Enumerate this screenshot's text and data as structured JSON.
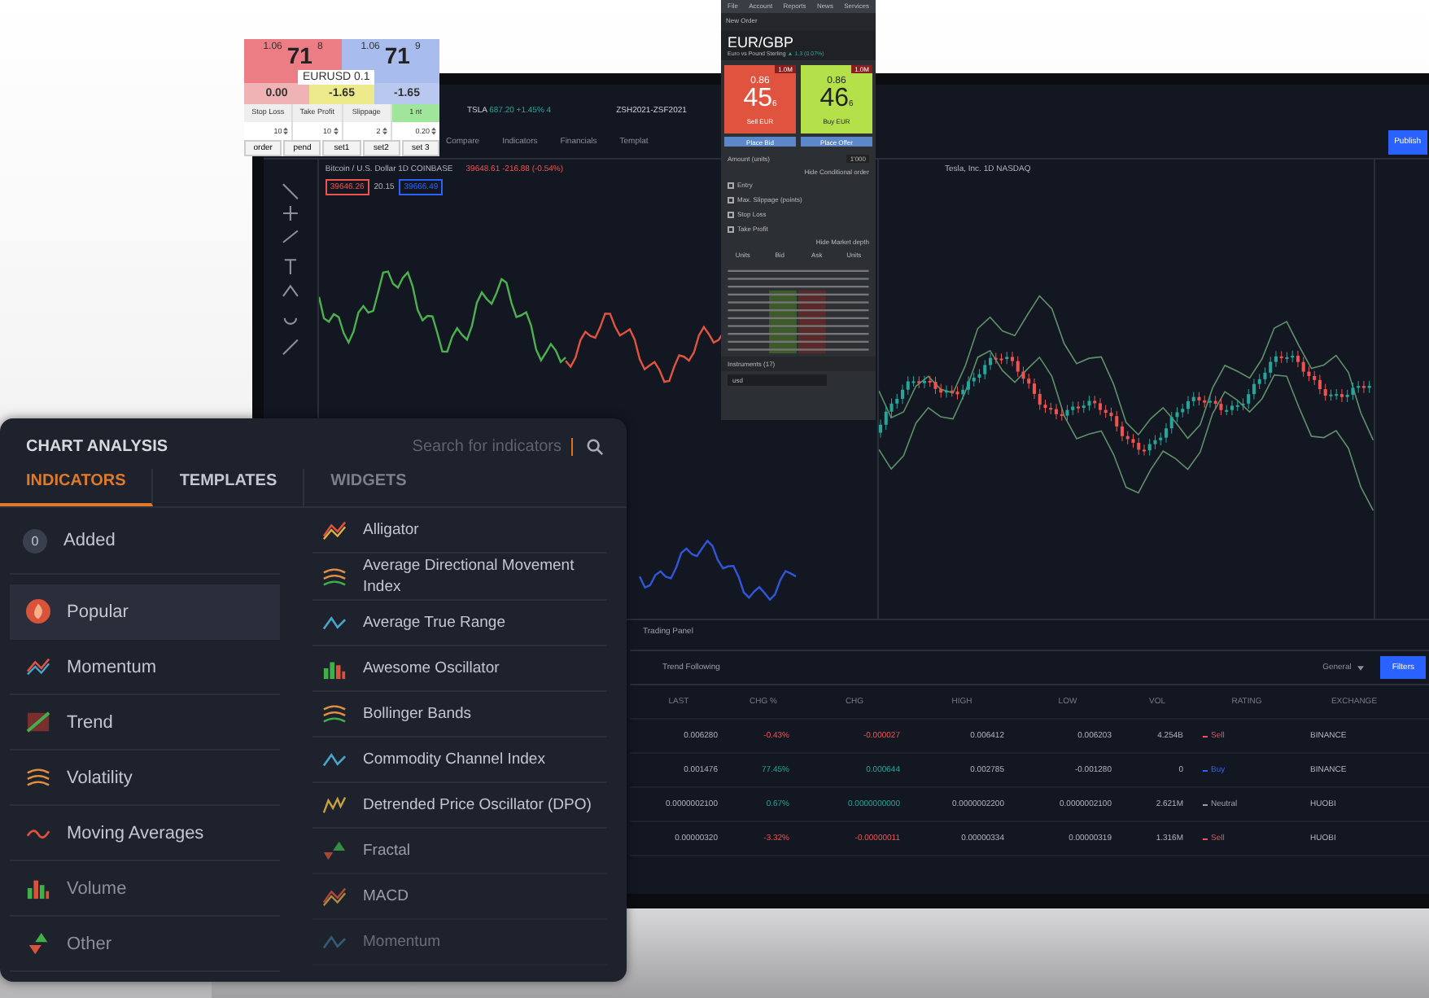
{
  "price_widget": {
    "bid": {
      "small": "1.06",
      "big": "71",
      "pip": "8"
    },
    "ask": {
      "small": "1.06",
      "big": "71",
      "pip": "9"
    },
    "symbol": "EURUSD 0.1",
    "values": [
      "0.00",
      "-1.65",
      "-1.65"
    ],
    "fields": [
      {
        "label": "Stop Loss",
        "value": "10",
        "selected": false
      },
      {
        "label": "Take Profit",
        "value": "10",
        "selected": false
      },
      {
        "label": "Slippage",
        "value": "2",
        "selected": false
      },
      {
        "label": "1 nt",
        "value": "0.20",
        "selected": true
      }
    ],
    "buttons": [
      "order",
      "pend",
      "set1",
      "set2",
      "set 3"
    ]
  },
  "order_panel": {
    "menu": [
      "File",
      "Account",
      "Reports",
      "News",
      "Services"
    ],
    "title": "New Order",
    "pair": "EUR/GBP",
    "pair_name": "Euro vs Pound Sterling",
    "change": "▲ 1.3 (0.07%)",
    "quotes": [
      {
        "kind": "sell",
        "small": "0.86",
        "big": "45",
        "pip": "6",
        "label": "Sell EUR",
        "tag": "1.0M",
        "button": "Place Bid"
      },
      {
        "kind": "buy",
        "small": "0.86",
        "big": "46",
        "pip": "6",
        "label": "Buy EUR",
        "tag": "1.0M",
        "button": "Place Offer"
      }
    ],
    "amount_label": "Amount (units)",
    "amount": "1'000",
    "conditional": "Hide Conditional order",
    "options": [
      {
        "label": "Entry",
        "checked": false
      },
      {
        "label": "Max. Slippage (points)",
        "checked": false
      },
      {
        "label": "Stop Loss",
        "checked": false
      },
      {
        "label": "Take Profit",
        "checked": false
      }
    ],
    "depth_toggle": "Hide Market depth",
    "depth_columns": [
      "Units",
      "Bid",
      "Ask",
      "Units"
    ],
    "instruments": "Instruments (17)",
    "filter": "usd"
  },
  "laptop": {
    "tickers": [
      {
        "symbol": "TSLA",
        "price": "687.20",
        "change": "+1.45% 4"
      },
      {
        "symbol": "ZSH2021-ZSF2021"
      }
    ],
    "toolbar": [
      "Compare",
      "Indicators",
      "Financials",
      "Templat"
    ],
    "publish": "Publish",
    "charts": [
      {
        "title": "Bitcoin / U.S. Dollar",
        "interval": "1D",
        "exchange": "COINBASE",
        "quote": "39648.61 -216.88 (-0.54%)",
        "sell": "39646.26",
        "spread": "20.15",
        "buy": "39666.49"
      },
      {
        "title": "Tesla, Inc.",
        "interval": "1D",
        "exchange": "NASDAQ"
      }
    ],
    "panel_tab": "Trading Panel",
    "filter_tab": "Trend Following",
    "general": "General",
    "filters_button": "Filters",
    "columns": [
      "LAST",
      "CHG %",
      "CHG",
      "HIGH",
      "LOW",
      "VOL",
      "RATING",
      "EXCHANGE"
    ],
    "rows": [
      {
        "cells": [
          "0.006280",
          "-0.43%",
          "-0.000027",
          "0.006412",
          "0.006203",
          "4.254B"
        ],
        "rating": "Sell",
        "kind": "sell",
        "exchange": "BINANCE"
      },
      {
        "cells": [
          "0.001476",
          "77.45%",
          "0.000644",
          "0.002785",
          "-0.001280",
          "0"
        ],
        "rating": "Buy",
        "kind": "buy",
        "exchange": "BINANCE"
      },
      {
        "cells": [
          "0.0000002100",
          "0.67%",
          "0.0000000000",
          "0.0000002200",
          "0.0000002100",
          "2.621M"
        ],
        "rating": "Neutral",
        "kind": "neutral",
        "exchange": "HUOBI"
      },
      {
        "cells": [
          "0.00000320",
          "-3.32%",
          "-0.00000011",
          "0.00000334",
          "0.00000319",
          "1.316M"
        ],
        "rating": "Sell",
        "kind": "sell",
        "exchange": "HUOBI"
      }
    ]
  },
  "chart_analysis": {
    "title": "CHART ANALYSIS",
    "search": {
      "placeholder": "Search for indicators"
    },
    "tabs": [
      {
        "label": "INDICATORS",
        "selected": true
      },
      {
        "label": "TEMPLATES",
        "selected": false
      },
      {
        "label": "WIDGETS",
        "selected": false
      }
    ],
    "added": {
      "count": "0",
      "label": "Added"
    },
    "categories": [
      {
        "label": "Popular",
        "selected": true
      },
      {
        "label": "Momentum",
        "selected": false
      },
      {
        "label": "Trend",
        "selected": false
      },
      {
        "label": "Volatility",
        "selected": false
      },
      {
        "label": "Moving Averages",
        "selected": false
      },
      {
        "label": "Volume",
        "selected": false
      },
      {
        "label": "Other",
        "selected": false
      }
    ],
    "indicators": [
      "Alligator",
      "Average Directional Movement Index",
      "Average True Range",
      "Awesome Oscillator",
      "Bollinger Bands",
      "Commodity Channel Index",
      "Detrended Price Oscillator (DPO)",
      "Fractal",
      "MACD",
      "Momentum"
    ]
  }
}
